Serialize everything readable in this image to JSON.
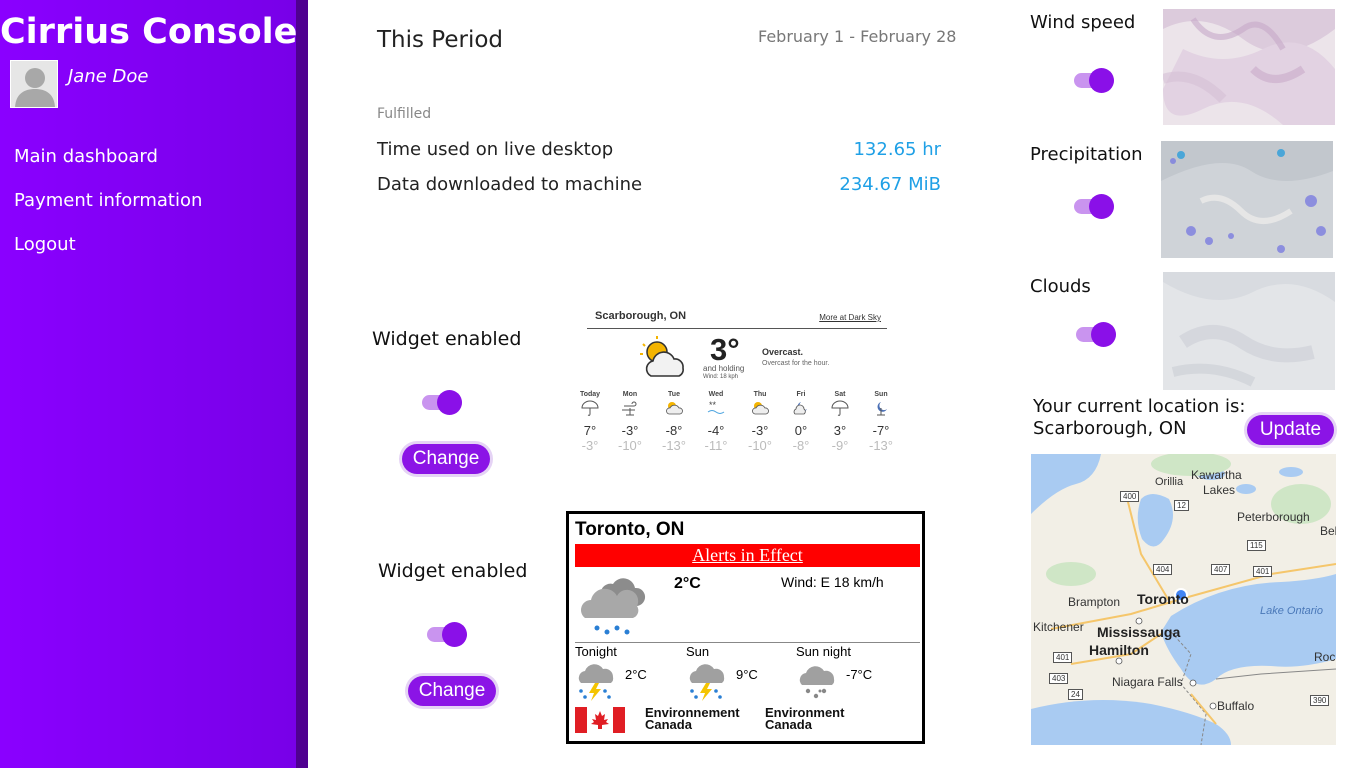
{
  "app": {
    "title": "Cirrius Console"
  },
  "user": {
    "name": "Jane Doe"
  },
  "nav": [
    {
      "label": "Main dashboard"
    },
    {
      "label": "Payment information"
    },
    {
      "label": "Logout"
    }
  ],
  "period": {
    "title": "This Period",
    "dates": "February 1 - February 28",
    "status": "Fulfilled",
    "rows": [
      {
        "label": "Time used on live desktop",
        "value": "132.65 hr"
      },
      {
        "label": "Data downloaded to machine",
        "value": "234.67 MiB"
      }
    ]
  },
  "widgets": [
    {
      "label": "Widget enabled",
      "enabled": true,
      "button": "Change"
    },
    {
      "label": "Widget enabled",
      "enabled": true,
      "button": "Change"
    }
  ],
  "darksky": {
    "location": "Scarborough, ON",
    "link": "More at Dark Sky",
    "temp": "3°",
    "trend": "and holding",
    "wind": "Wind: 18 kph",
    "condition": "Overcast.",
    "detail": "Overcast for the hour.",
    "days": [
      {
        "day": "Today",
        "hi": "7°",
        "lo": "-3°",
        "icon": "umbrella-icon"
      },
      {
        "day": "Mon",
        "hi": "-3°",
        "lo": "-10°",
        "icon": "wind-icon"
      },
      {
        "day": "Tue",
        "hi": "-8°",
        "lo": "-13°",
        "icon": "partly-cloudy-icon"
      },
      {
        "day": "Wed",
        "hi": "-4°",
        "lo": "-11°",
        "icon": "snow-icon"
      },
      {
        "day": "Thu",
        "hi": "-3°",
        "lo": "-10°",
        "icon": "partly-cloudy-icon"
      },
      {
        "day": "Fri",
        "hi": "0°",
        "lo": "-8°",
        "icon": "night-cloudy-icon"
      },
      {
        "day": "Sat",
        "hi": "3°",
        "lo": "-9°",
        "icon": "umbrella-icon"
      },
      {
        "day": "Sun",
        "hi": "-7°",
        "lo": "-13°",
        "icon": "night-wind-icon"
      }
    ]
  },
  "envcanada": {
    "city": "Toronto, ON",
    "alert": "Alerts in Effect",
    "temp": "2°C",
    "wind": "Wind: E 18 km/h",
    "forecast": [
      {
        "name": "Tonight",
        "temp": "2°C",
        "icon": "rain-thunder-icon"
      },
      {
        "name": "Sun",
        "temp": "9°C",
        "icon": "rain-thunder-icon"
      },
      {
        "name": "Sun night",
        "temp": "-7°C",
        "icon": "snow-cloud-icon"
      }
    ],
    "brand": [
      "Environnement",
      "Canada"
    ],
    "brand2": [
      "Environment",
      "Canada"
    ]
  },
  "layers": [
    {
      "label": "Wind speed",
      "enabled": true
    },
    {
      "label": "Precipitation",
      "enabled": true
    },
    {
      "label": "Clouds",
      "enabled": true
    }
  ],
  "location": {
    "line1": "Your current location is:",
    "line2": "Scarborough, ON",
    "button": "Update"
  },
  "map": {
    "labels": [
      "Orillia",
      "Kawartha",
      "Lakes",
      "Peterborough",
      "Bel",
      "Brampton",
      "Toronto",
      "Kitchener",
      "Mississauga",
      "Hamilton",
      "Lake Ontario",
      "Roche",
      "Niagara Falls",
      "Buffalo"
    ],
    "highways": [
      "400",
      "12",
      "115",
      "404",
      "407",
      "401",
      "401",
      "403",
      "24",
      "390"
    ]
  },
  "colors": {
    "sidebar": "#8a00ff",
    "accent": "#8b14e6",
    "value": "#1fa0e6",
    "alert": "#ff0000"
  }
}
